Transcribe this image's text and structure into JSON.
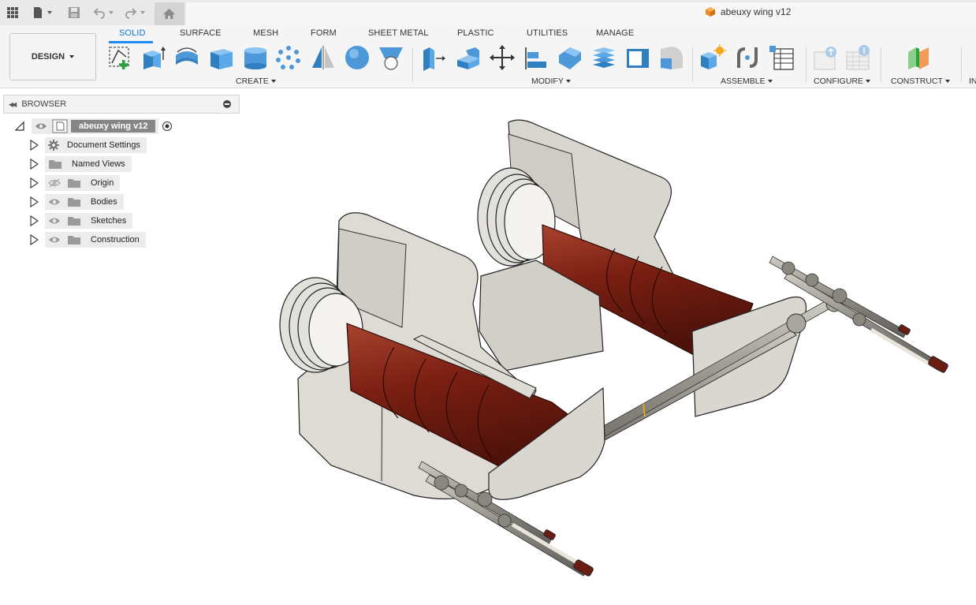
{
  "quick_access": {
    "apps_icon": "grid-icon",
    "file_icon": "file-icon",
    "save_icon": "save-icon",
    "undo_icon": "undo-icon",
    "redo_icon": "redo-icon",
    "home_icon": "home-icon"
  },
  "document": {
    "title": "abeuxy wing v12",
    "icon_color": "#f08a24"
  },
  "workspace": {
    "label": "DESIGN"
  },
  "tabs": [
    {
      "label": "SOLID",
      "active": true
    },
    {
      "label": "SURFACE"
    },
    {
      "label": "MESH"
    },
    {
      "label": "FORM"
    },
    {
      "label": "SHEET METAL"
    },
    {
      "label": "PLASTIC"
    },
    {
      "label": "UTILITIES"
    },
    {
      "label": "MANAGE"
    }
  ],
  "groups": {
    "create": "CREATE",
    "modify": "MODIFY",
    "assemble": "ASSEMBLE",
    "configure": "CONFIGURE",
    "construct": "CONSTRUCT",
    "inspect": "IN"
  },
  "browser": {
    "title": "BROWSER",
    "root": "abeuxy wing v12",
    "items": [
      {
        "label": "Document Settings",
        "icon": "gear-icon"
      },
      {
        "label": "Named Views",
        "icon": "folder-icon"
      },
      {
        "label": "Origin",
        "icon": "folder-icon",
        "hidden": true
      },
      {
        "label": "Bodies",
        "icon": "folder-icon"
      },
      {
        "label": "Sketches",
        "icon": "folder-icon"
      },
      {
        "label": "Construction",
        "icon": "folder-icon"
      }
    ]
  },
  "colors": {
    "accent": "#1f8ded",
    "ribbon_bg": "#f5f5f5",
    "body_red": "#7a1f12",
    "plate_gray": "#e4e2dc"
  }
}
